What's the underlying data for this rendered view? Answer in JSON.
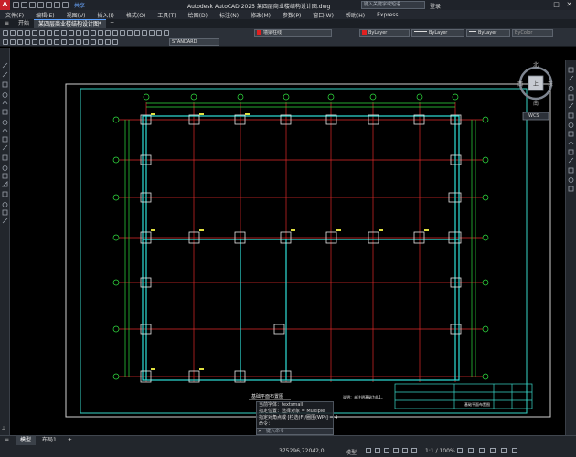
{
  "title": {
    "app_logo": "A",
    "share": "共享",
    "text": "Autodesk AutoCAD 2025  某四层商业楼结构设计图.dwg",
    "search_placeholder": "键入关键字或短语",
    "user": "登录",
    "minimize": "—",
    "maximize": "□",
    "close": "✕"
  },
  "menu": [
    "文件(F)",
    "编辑(E)",
    "视图(V)",
    "插入(I)",
    "格式(O)",
    "工具(T)",
    "绘图(D)",
    "标注(N)",
    "修改(M)",
    "参数(P)",
    "窗口(W)",
    "帮助(H)",
    "Express"
  ],
  "tabs": {
    "start": "开始",
    "active": "某四层商业楼结构设计图*",
    "add": "+"
  },
  "toolbar": {
    "text_style": "STANDARD",
    "layer": "墙梁柱线",
    "color": "ByLayer",
    "linetype": "ByLayer",
    "lineweight": "ByLayer",
    "plot_style": "ByColor",
    "layer_color": "#e02020",
    "color_swatch": "#e02020"
  },
  "viewcube": {
    "north": "北",
    "south": "南",
    "east": "东",
    "west": "西",
    "top": "上",
    "wcs": "WCS"
  },
  "drawing": {
    "plan_label": "基础平面布置图",
    "note": "说明：未注明基础为JL1。",
    "titleblock_name": "基础平面布置图"
  },
  "command": {
    "history": [
      "当前字体：textsmall",
      "指定位置：选择对象 = Multiple",
      "指定对角点或 [栏选(F)/圈围(WP)] = 4",
      "命令："
    ],
    "prompt": "键入命令",
    "close": "✕"
  },
  "layouts": {
    "menu": "≡",
    "model": "模型",
    "layout1": "布局1",
    "add": "+"
  },
  "status": {
    "coords": "375296,72042,0",
    "model": "模型",
    "ratio": "1:1 / 100%"
  }
}
